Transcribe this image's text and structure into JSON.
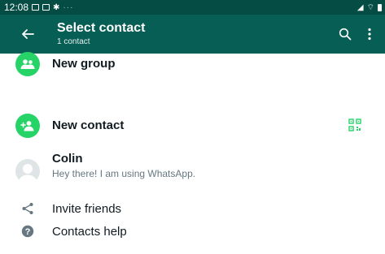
{
  "status_bar": {
    "time": "12:08",
    "more": "···"
  },
  "header": {
    "title": "Select contact",
    "subtitle": "1 contact"
  },
  "actions": {
    "new_group": "New group",
    "new_contact": "New contact"
  },
  "contacts": [
    {
      "name": "Colin",
      "status": "Hey there! I am using WhatsApp."
    }
  ],
  "footer_actions": {
    "invite": "Invite friends",
    "help": "Contacts help"
  },
  "colors": {
    "status_bar": "#054d44",
    "app_bar": "#075e54",
    "accent": "#25d366"
  },
  "icons": {
    "back": "arrow-back-icon",
    "search": "search-icon",
    "menu": "more-vert-icon",
    "new_group": "group-icon",
    "new_contact": "add-person-icon",
    "qr": "qr-code-icon",
    "invite": "share-icon",
    "help": "help-icon"
  }
}
